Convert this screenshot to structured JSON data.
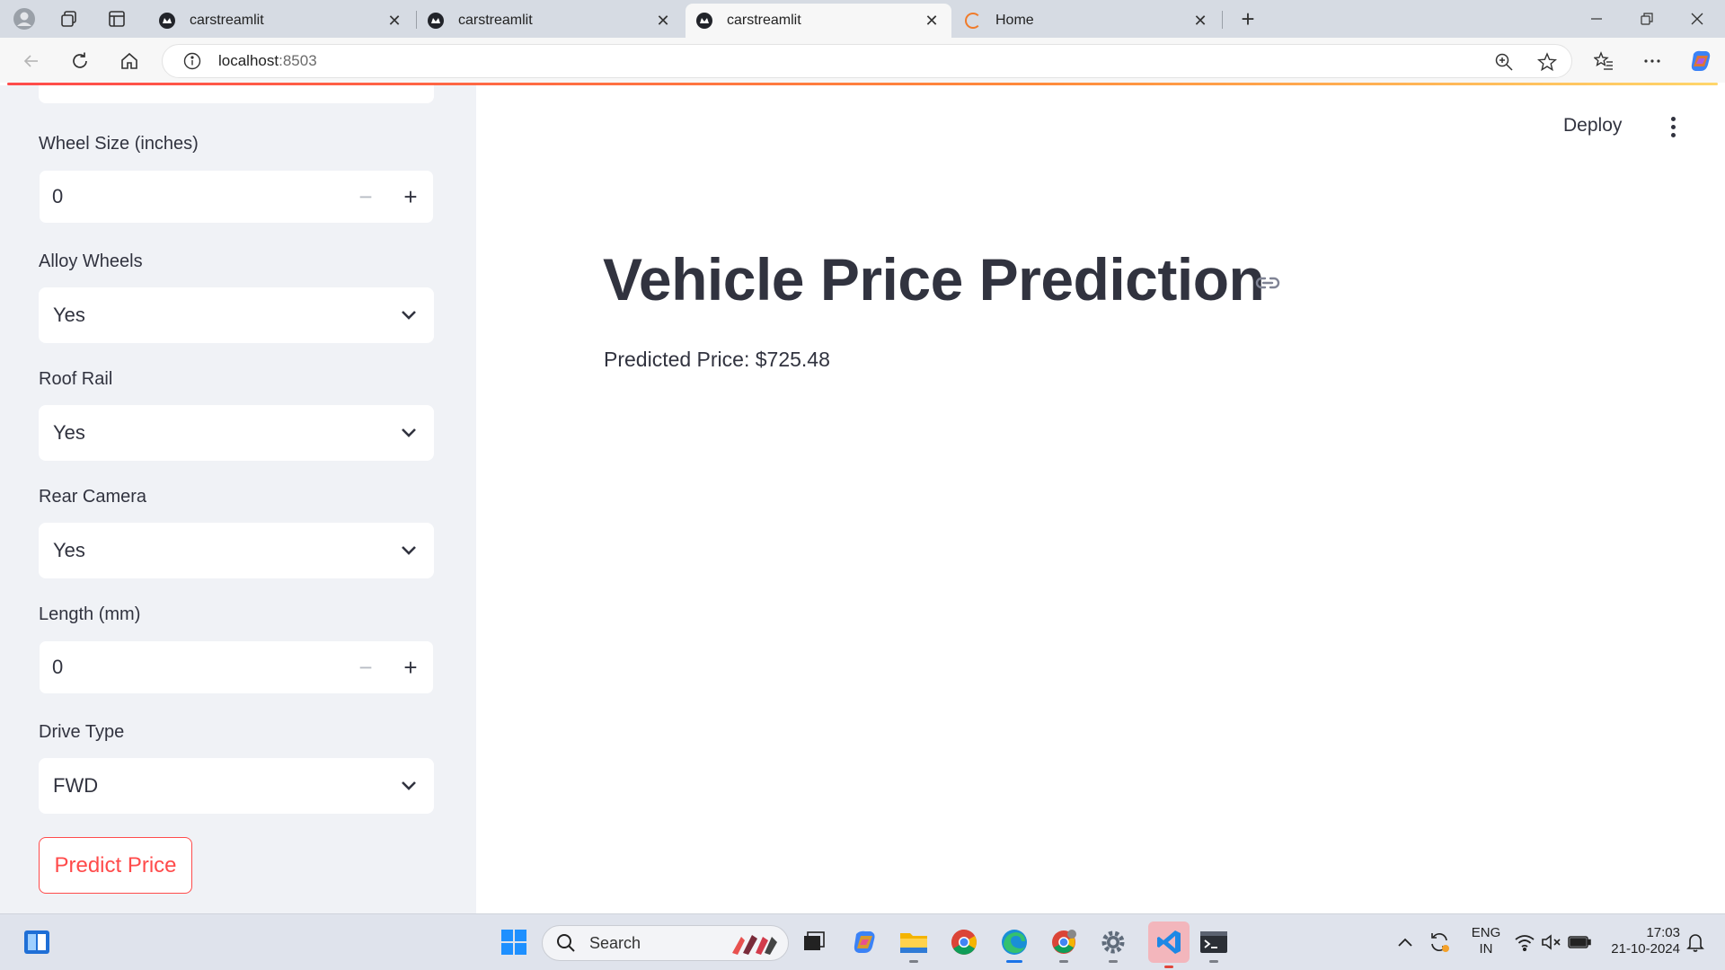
{
  "browser": {
    "tabs": [
      {
        "title": "carstreamlit",
        "active": false
      },
      {
        "title": "carstreamlit",
        "active": false
      },
      {
        "title": "carstreamlit",
        "active": true
      },
      {
        "title": "Home",
        "active": false
      }
    ],
    "close_glyph": "✕",
    "new_tab_glyph": "+",
    "url_host": "localhost",
    "url_port": ":8503"
  },
  "sidebar": {
    "fields": [
      {
        "label": "Wheel Size (inches)",
        "type": "number",
        "value": "0"
      },
      {
        "label": "Alloy Wheels",
        "type": "select",
        "value": "Yes"
      },
      {
        "label": "Roof Rail",
        "type": "select",
        "value": "Yes"
      },
      {
        "label": "Rear Camera",
        "type": "select",
        "value": "Yes"
      },
      {
        "label": "Length (mm)",
        "type": "number",
        "value": "0"
      },
      {
        "label": "Drive Type",
        "type": "select",
        "value": "FWD"
      }
    ],
    "minus_glyph": "−",
    "plus_glyph": "+",
    "predict_button": "Predict Price"
  },
  "main": {
    "deploy_label": "Deploy",
    "title": "Vehicle Price Prediction",
    "result_text": "Predicted Price: $725.48"
  },
  "taskbar": {
    "search_label": "Search",
    "language": "ENG",
    "region": "IN",
    "time": "17:03",
    "date": "21-10-2024"
  },
  "colors": {
    "accent": "#ff4b4b",
    "sidebar_bg": "#f0f2f6",
    "text": "#31333f"
  }
}
